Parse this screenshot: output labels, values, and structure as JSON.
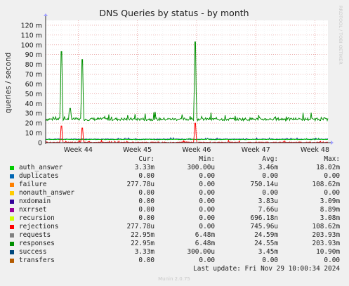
{
  "chart_data": {
    "type": "line",
    "title": "DNS Queries by status - by month",
    "ylabel": "queries / second",
    "side_label": "RRDTOOL / TOBI OETIKER",
    "ylim": [
      0,
      0.125
    ],
    "yticks": [
      {
        "v": 0,
        "label": "0"
      },
      {
        "v": 0.01,
        "label": "10 m"
      },
      {
        "v": 0.02,
        "label": "20 m"
      },
      {
        "v": 0.03,
        "label": "30 m"
      },
      {
        "v": 0.04,
        "label": "40 m"
      },
      {
        "v": 0.05,
        "label": "50 m"
      },
      {
        "v": 0.06,
        "label": "60 m"
      },
      {
        "v": 0.07,
        "label": "70 m"
      },
      {
        "v": 0.08,
        "label": "80 m"
      },
      {
        "v": 0.09,
        "label": "90 m"
      },
      {
        "v": 0.1,
        "label": "100 m"
      },
      {
        "v": 0.11,
        "label": "110 m"
      },
      {
        "v": 0.12,
        "label": "120 m"
      }
    ],
    "xticks": [
      "Week 44",
      "Week 45",
      "Week 46",
      "Week 47",
      "Week 48"
    ],
    "columns": [
      "Cur:",
      "Min:",
      "Avg:",
      "Max:"
    ],
    "series": [
      {
        "name": "auth_answer",
        "color": "#00cc00",
        "cur": "3.33m",
        "min": "300.00u",
        "avg": "3.46m",
        "max": "18.02m"
      },
      {
        "name": "duplicates",
        "color": "#0066b3",
        "cur": "0.00",
        "min": "0.00",
        "avg": "0.00",
        "max": "0.00"
      },
      {
        "name": "failure",
        "color": "#ff8000",
        "cur": "277.78u",
        "min": "0.00",
        "avg": "750.14u",
        "max": "108.62m"
      },
      {
        "name": "nonauth_answer",
        "color": "#ffcc00",
        "cur": "0.00",
        "min": "0.00",
        "avg": "0.00",
        "max": "0.00"
      },
      {
        "name": "nxdomain",
        "color": "#330099",
        "cur": "0.00",
        "min": "0.00",
        "avg": "3.83u",
        "max": "3.09m"
      },
      {
        "name": "nxrrset",
        "color": "#990099",
        "cur": "0.00",
        "min": "0.00",
        "avg": "7.66u",
        "max": "8.89m"
      },
      {
        "name": "recursion",
        "color": "#ccff00",
        "cur": "0.00",
        "min": "0.00",
        "avg": "696.18n",
        "max": "3.08m"
      },
      {
        "name": "rejections",
        "color": "#ff0000",
        "cur": "277.78u",
        "min": "0.00",
        "avg": "745.96u",
        "max": "108.62m"
      },
      {
        "name": "requests",
        "color": "#808080",
        "cur": "22.95m",
        "min": "6.48m",
        "avg": "24.59m",
        "max": "203.93m"
      },
      {
        "name": "responses",
        "color": "#008f00",
        "cur": "22.95m",
        "min": "6.48m",
        "avg": "24.55m",
        "max": "203.93m"
      },
      {
        "name": "success",
        "color": "#00487d",
        "cur": "3.33m",
        "min": "300.00u",
        "avg": "3.45m",
        "max": "10.90m"
      },
      {
        "name": "transfers",
        "color": "#b35a00",
        "cur": "0.00",
        "min": "0.00",
        "avg": "0.00",
        "max": "0.00"
      }
    ],
    "responses_peaks": [
      {
        "week": 43.72,
        "v": 0.093
      },
      {
        "week": 43.86,
        "v": 0.035
      },
      {
        "week": 44.07,
        "v": 0.085
      },
      {
        "week": 45.98,
        "v": 0.103
      }
    ],
    "rejections_peaks": [
      {
        "week": 43.72,
        "v": 0.017
      },
      {
        "week": 44.07,
        "v": 0.015
      },
      {
        "week": 45.98,
        "v": 0.02
      }
    ],
    "responses_baseline": 0.024,
    "success_level": 0.0035
  },
  "last_update": "Last update: Fri Nov 29 10:00:34 2024",
  "footer": "Munin 2.0.75"
}
